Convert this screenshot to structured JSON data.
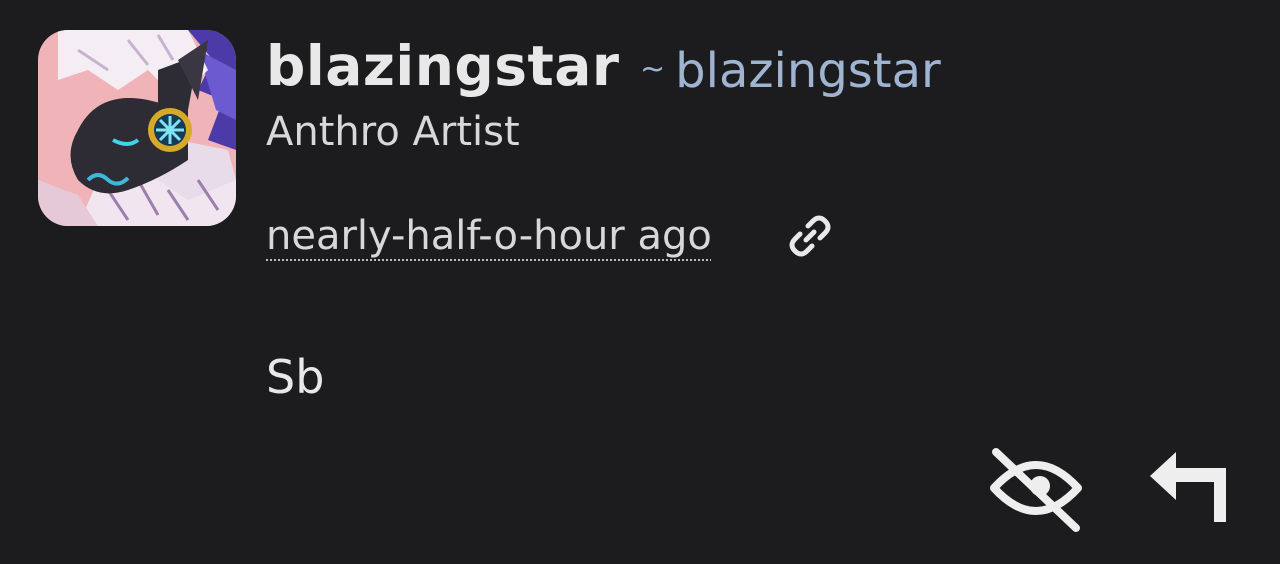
{
  "comment": {
    "author": {
      "display_name": "blazingstar",
      "username_prefix": "~",
      "username": "blazingstar",
      "title": "Anthro Artist",
      "avatar": "avatar-image"
    },
    "timestamp": "nearly-half-o-hour ago",
    "permalink_icon": "link-icon",
    "body": "Sb",
    "actions": {
      "hide_icon": "eye-off-icon",
      "reply_icon": "reply-arrow-icon"
    }
  },
  "colors": {
    "background": "#1c1c1f",
    "text": "#e8e8e8",
    "username_link": "#9fb4d0",
    "avatar_background": "#f0b3b8"
  }
}
